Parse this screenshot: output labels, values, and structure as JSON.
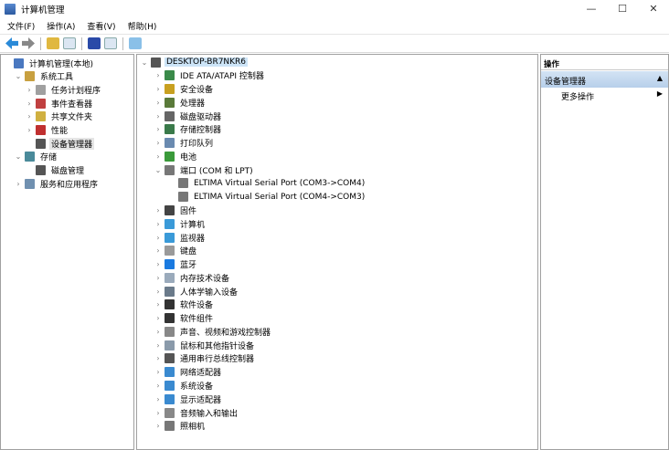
{
  "window": {
    "title": "计算机管理",
    "minimize": "—",
    "maximize": "☐",
    "close": "✕"
  },
  "menu": [
    "文件(F)",
    "操作(A)",
    "查看(V)",
    "帮助(H)"
  ],
  "toolbar": [
    "back-icon",
    "forward-icon",
    "up-folder-icon",
    "show-hide-tree-icon",
    "help-icon",
    "show-hide-action-icon",
    "monitor-icon"
  ],
  "left_tree": [
    {
      "label": "计算机管理(本地)",
      "level": 0,
      "chev": "",
      "color": "#4a78c0"
    },
    {
      "label": "系统工具",
      "level": 1,
      "chev": "⌄",
      "color": "#c8a040"
    },
    {
      "label": "任务计划程序",
      "level": 2,
      "chev": "›",
      "color": "#a0a0a0"
    },
    {
      "label": "事件查看器",
      "level": 2,
      "chev": "›",
      "color": "#c04040"
    },
    {
      "label": "共享文件夹",
      "level": 2,
      "chev": "›",
      "color": "#d0b040"
    },
    {
      "label": "性能",
      "level": 2,
      "chev": "›",
      "color": "#c03030"
    },
    {
      "label": "设备管理器",
      "level": 2,
      "chev": "",
      "color": "#555555",
      "selected": true
    },
    {
      "label": "存储",
      "level": 1,
      "chev": "⌄",
      "color": "#4a8a9a"
    },
    {
      "label": "磁盘管理",
      "level": 2,
      "chev": "",
      "color": "#555555"
    },
    {
      "label": "服务和应用程序",
      "level": 1,
      "chev": "›",
      "color": "#7090b0"
    }
  ],
  "device_tree": [
    {
      "label": "DESKTOP-BR7NKR6",
      "level": 0,
      "chev": "⌄",
      "color": "#555555",
      "selected": true
    },
    {
      "label": "IDE ATA/ATAPI 控制器",
      "level": 1,
      "chev": "›",
      "color": "#3a8a4a"
    },
    {
      "label": "安全设备",
      "level": 1,
      "chev": "›",
      "color": "#c8a020"
    },
    {
      "label": "处理器",
      "level": 1,
      "chev": "›",
      "color": "#5a7a3a"
    },
    {
      "label": "磁盘驱动器",
      "level": 1,
      "chev": "›",
      "color": "#666666"
    },
    {
      "label": "存储控制器",
      "level": 1,
      "chev": "›",
      "color": "#3a7a4a"
    },
    {
      "label": "打印队列",
      "level": 1,
      "chev": "›",
      "color": "#6a8ab0"
    },
    {
      "label": "电池",
      "level": 1,
      "chev": "›",
      "color": "#3a9a3a"
    },
    {
      "label": "端口 (COM 和 LPT)",
      "level": 1,
      "chev": "⌄",
      "color": "#777777"
    },
    {
      "label": "ELTIMA Virtual Serial Port (COM3->COM4)",
      "level": 2,
      "chev": "",
      "color": "#777777"
    },
    {
      "label": "ELTIMA Virtual Serial Port (COM4->COM3)",
      "level": 2,
      "chev": "",
      "color": "#777777"
    },
    {
      "label": "固件",
      "level": 1,
      "chev": "›",
      "color": "#444444"
    },
    {
      "label": "计算机",
      "level": 1,
      "chev": "›",
      "color": "#3a9ad8"
    },
    {
      "label": "监视器",
      "level": 1,
      "chev": "›",
      "color": "#3a9ad8"
    },
    {
      "label": "键盘",
      "level": 1,
      "chev": "›",
      "color": "#9a9a9a"
    },
    {
      "label": "蓝牙",
      "level": 1,
      "chev": "›",
      "color": "#1a7ae0"
    },
    {
      "label": "内存技术设备",
      "level": 1,
      "chev": "›",
      "color": "#9aaabb"
    },
    {
      "label": "人体学输入设备",
      "level": 1,
      "chev": "›",
      "color": "#6a7a8a"
    },
    {
      "label": "软件设备",
      "level": 1,
      "chev": "›",
      "color": "#333333"
    },
    {
      "label": "软件组件",
      "level": 1,
      "chev": "›",
      "color": "#333333"
    },
    {
      "label": "声音、视频和游戏控制器",
      "level": 1,
      "chev": "›",
      "color": "#888888"
    },
    {
      "label": "鼠标和其他指针设备",
      "level": 1,
      "chev": "›",
      "color": "#8a9aaa"
    },
    {
      "label": "通用串行总线控制器",
      "level": 1,
      "chev": "›",
      "color": "#555555"
    },
    {
      "label": "网络适配器",
      "level": 1,
      "chev": "›",
      "color": "#3a8ad0"
    },
    {
      "label": "系统设备",
      "level": 1,
      "chev": "›",
      "color": "#3a8ad0"
    },
    {
      "label": "显示适配器",
      "level": 1,
      "chev": "›",
      "color": "#3a8ad0"
    },
    {
      "label": "音频输入和输出",
      "level": 1,
      "chev": "›",
      "color": "#888888"
    },
    {
      "label": "照相机",
      "level": 1,
      "chev": "›",
      "color": "#777777"
    }
  ],
  "actions": {
    "header": "操作",
    "section": "设备管理器",
    "section_arrow": "▲",
    "more": "更多操作",
    "more_arrow": "▶"
  }
}
